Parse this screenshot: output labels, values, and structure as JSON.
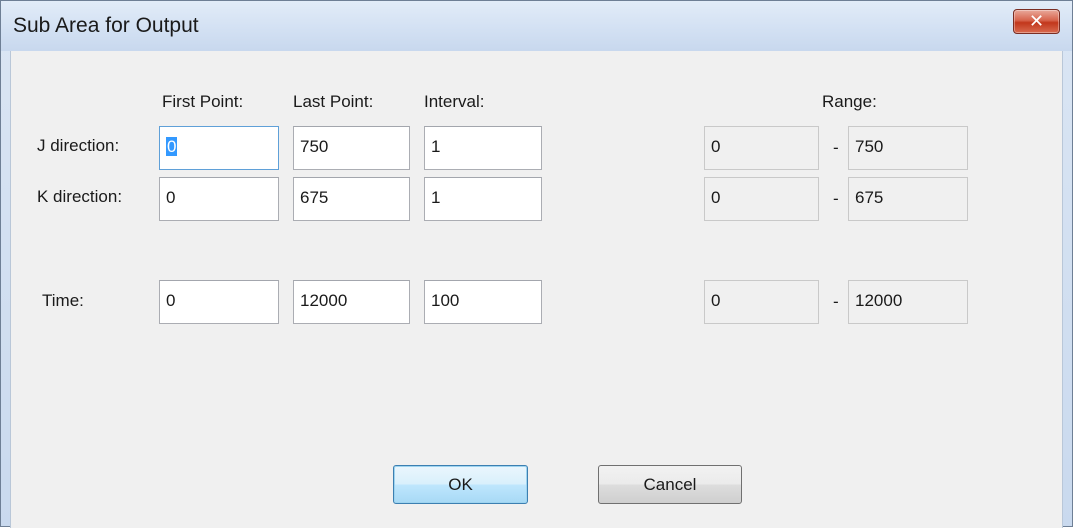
{
  "window": {
    "title": "Sub Area for Output",
    "close_glyph": "✕"
  },
  "headers": {
    "first_point": "First Point:",
    "last_point": "Last Point:",
    "interval": "Interval:",
    "range": "Range:"
  },
  "rows": {
    "j": {
      "label": "J direction:",
      "first": "0",
      "last": "750",
      "interval": "1",
      "range_min": "0",
      "range_sep": "-",
      "range_max": "750"
    },
    "k": {
      "label": "K direction:",
      "first": "0",
      "last": "675",
      "interval": "1",
      "range_min": "0",
      "range_sep": "-",
      "range_max": "675"
    },
    "time": {
      "label": "Time:",
      "first": "0",
      "last": "12000",
      "interval": "100",
      "range_min": "0",
      "range_sep": "-",
      "range_max": "12000"
    }
  },
  "buttons": {
    "ok": "OK",
    "cancel": "Cancel"
  }
}
